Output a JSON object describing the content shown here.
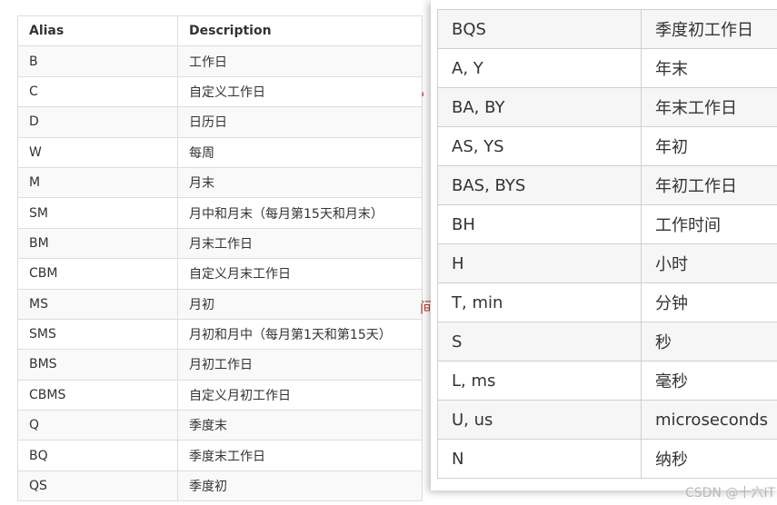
{
  "left_table": {
    "headers": [
      "Alias",
      "Description"
    ],
    "rows": [
      [
        "B",
        "工作日"
      ],
      [
        "C",
        "自定义工作日"
      ],
      [
        "D",
        "日历日"
      ],
      [
        "W",
        "每周"
      ],
      [
        "M",
        "月末"
      ],
      [
        "SM",
        "月中和月末（每月第15天和月末）"
      ],
      [
        "BM",
        "月末工作日"
      ],
      [
        "CBM",
        "自定义月末工作日"
      ],
      [
        "MS",
        "月初"
      ],
      [
        "SMS",
        "月初和月中（每月第1天和第15天）"
      ],
      [
        "BMS",
        "月初工作日"
      ],
      [
        "CBMS",
        "自定义月初工作日"
      ],
      [
        "Q",
        "季度末"
      ],
      [
        "BQ",
        "季度末工作日"
      ],
      [
        "QS",
        "季度初"
      ]
    ]
  },
  "right_table": {
    "rows": [
      [
        "BQS",
        "季度初工作日"
      ],
      [
        "A, Y",
        "年末"
      ],
      [
        "BA, BY",
        "年末工作日"
      ],
      [
        "AS, YS",
        "年初"
      ],
      [
        "BAS, BYS",
        "年初工作日"
      ],
      [
        "BH",
        "工作时间"
      ],
      [
        "H",
        "小时"
      ],
      [
        "T, min",
        "分钟"
      ],
      [
        "S",
        "秒"
      ],
      [
        "L, ms",
        "毫秒"
      ],
      [
        "U, us",
        "microseconds"
      ],
      [
        "N",
        "纳秒"
      ]
    ]
  },
  "background_fragments": [
    "'",
    "间"
  ],
  "watermark": "CSDN @十六IT"
}
